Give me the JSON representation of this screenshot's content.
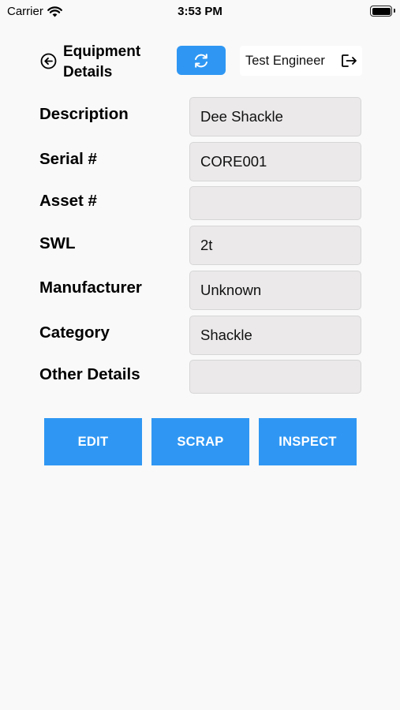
{
  "status_bar": {
    "carrier": "Carrier",
    "time": "3:53 PM"
  },
  "header": {
    "title": "Equipment Details",
    "user_name": "Test Engineer",
    "accent_color": "#2f97f3"
  },
  "icons": {
    "back": "back-arrow-icon",
    "refresh": "refresh-icon",
    "logout": "logout-icon",
    "wifi": "wifi-icon",
    "battery": "battery-icon"
  },
  "fields": [
    {
      "label": "Description",
      "value": "Dee Shackle"
    },
    {
      "label": "Serial #",
      "value": "CORE001"
    },
    {
      "label": "Asset #",
      "value": ""
    },
    {
      "label": "SWL",
      "value": "2t"
    },
    {
      "label": "Manufacturer",
      "value": "Unknown"
    },
    {
      "label": "Category",
      "value": "Shackle"
    },
    {
      "label": "Other Details",
      "value": ""
    }
  ],
  "actions": {
    "edit": "EDIT",
    "scrap": "SCRAP",
    "inspect": "INSPECT"
  }
}
